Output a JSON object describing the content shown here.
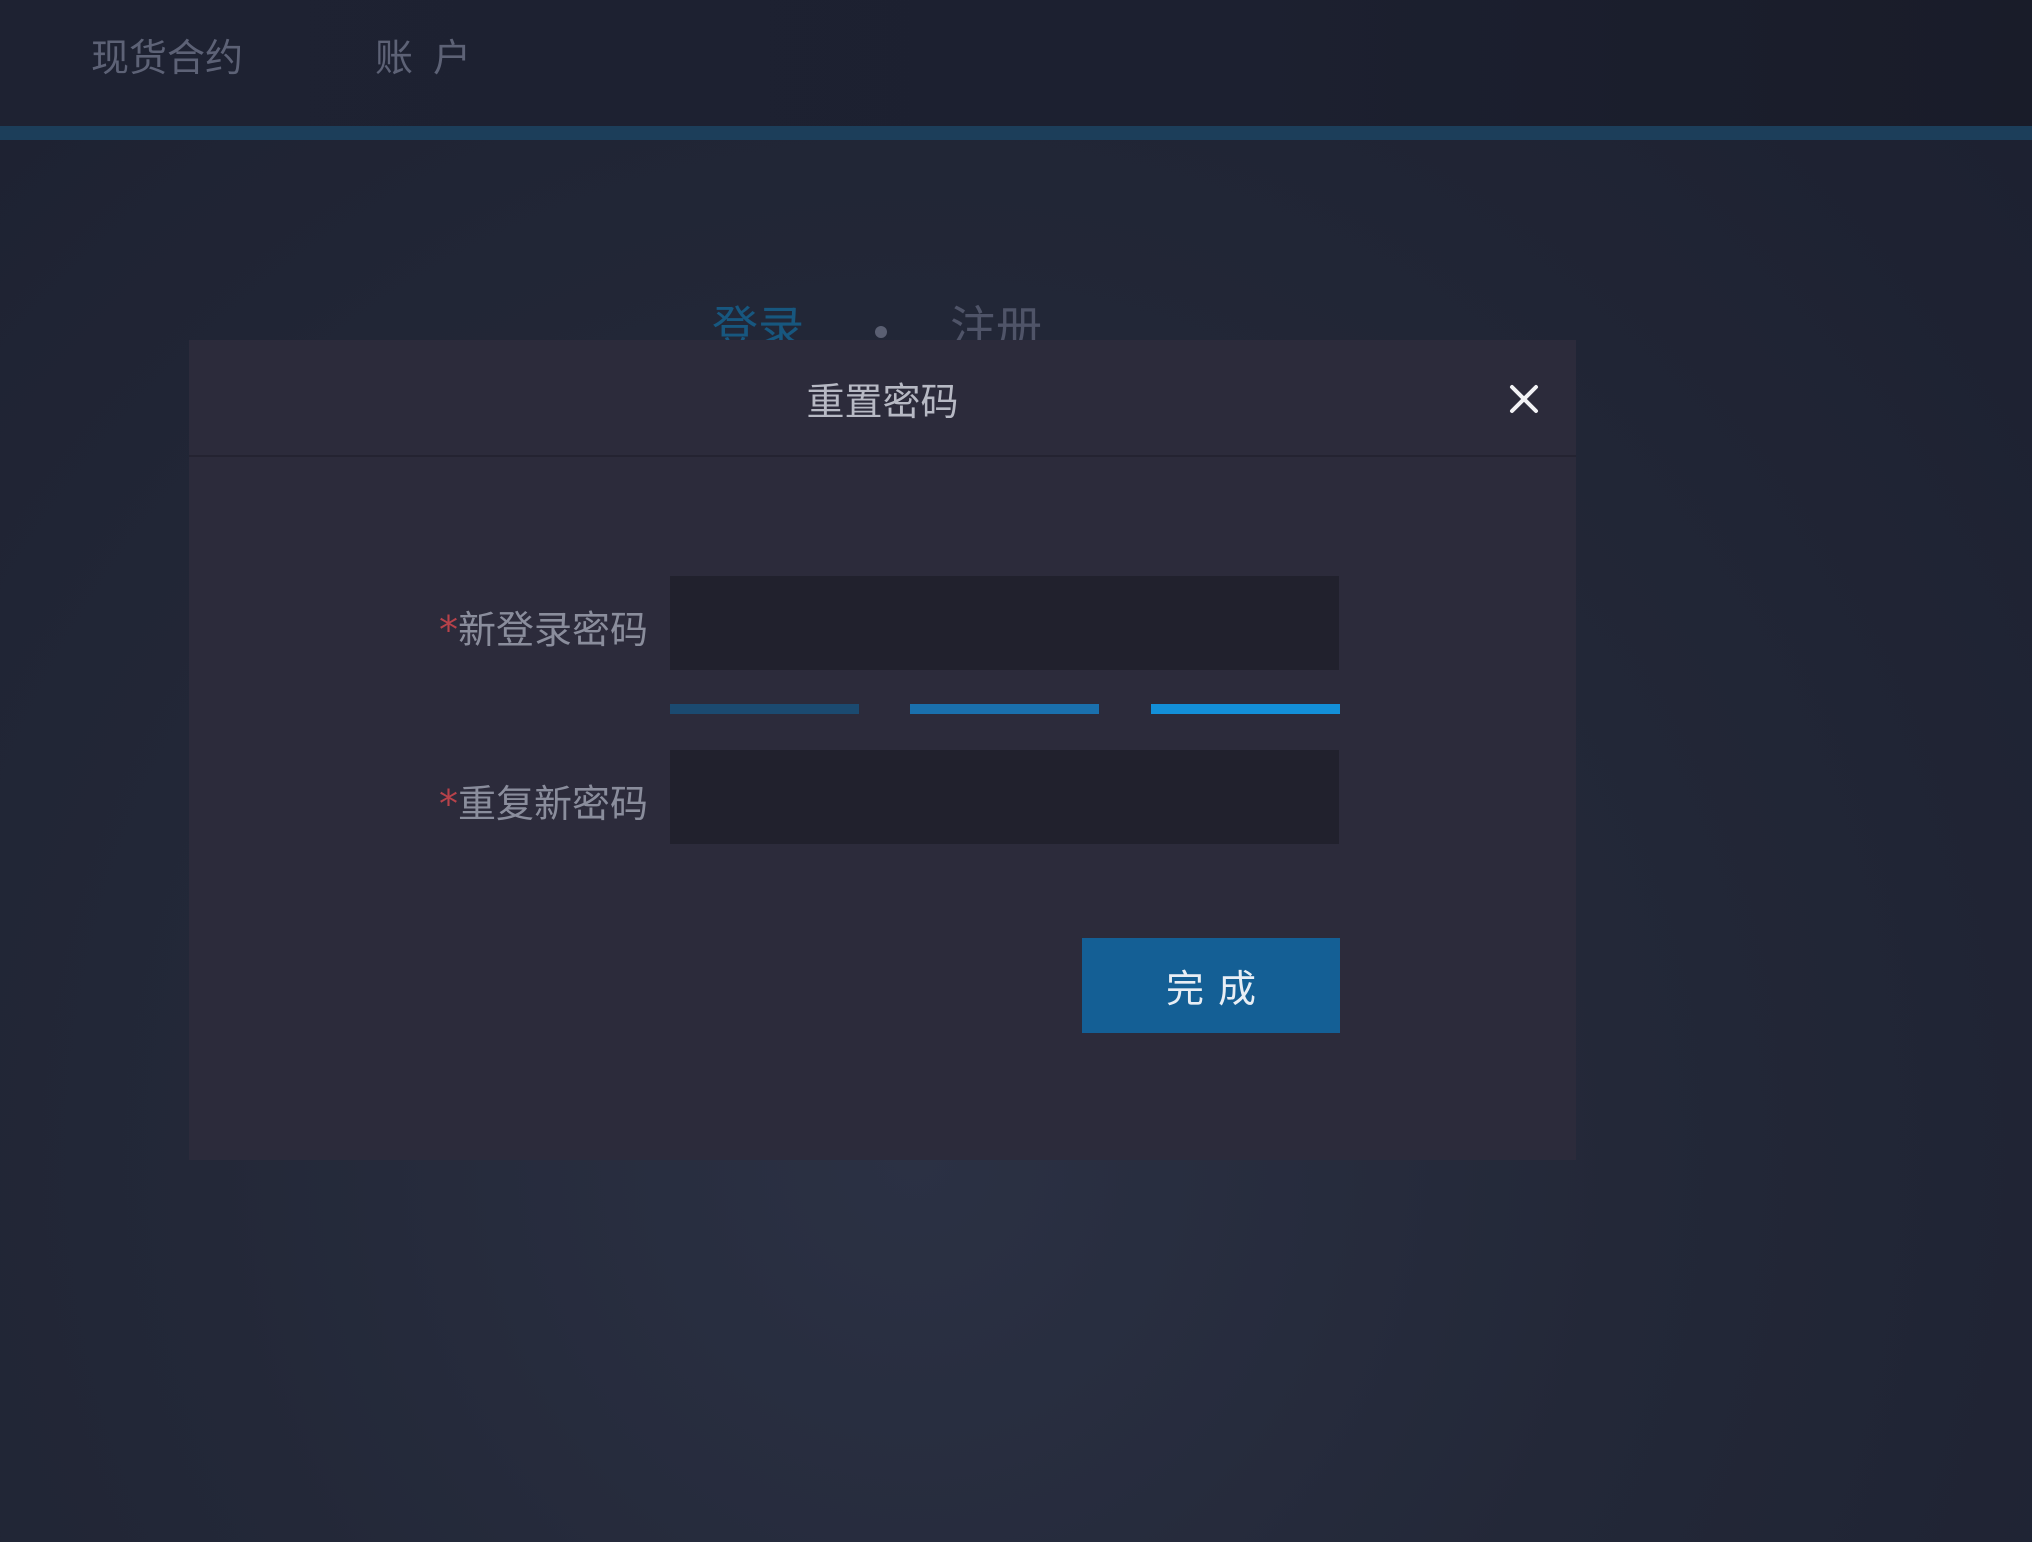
{
  "nav": {
    "spot_contracts": "现货合约",
    "account": "账户"
  },
  "background_tabs": {
    "login": "登录",
    "register": "注册"
  },
  "modal": {
    "title": "重置密码",
    "close_icon": "close-icon",
    "required_mark": "*",
    "new_password_label": "新登录密码",
    "new_password_value": "",
    "repeat_password_label": "重复新密码",
    "repeat_password_value": "",
    "strength_levels": 3,
    "submit_label": "完成"
  },
  "colors": {
    "accent": "#145f95",
    "required": "#b8424a",
    "strength_weak": "#1b4a70",
    "strength_medium": "#1a70ad",
    "strength_strong": "#138fd8"
  }
}
